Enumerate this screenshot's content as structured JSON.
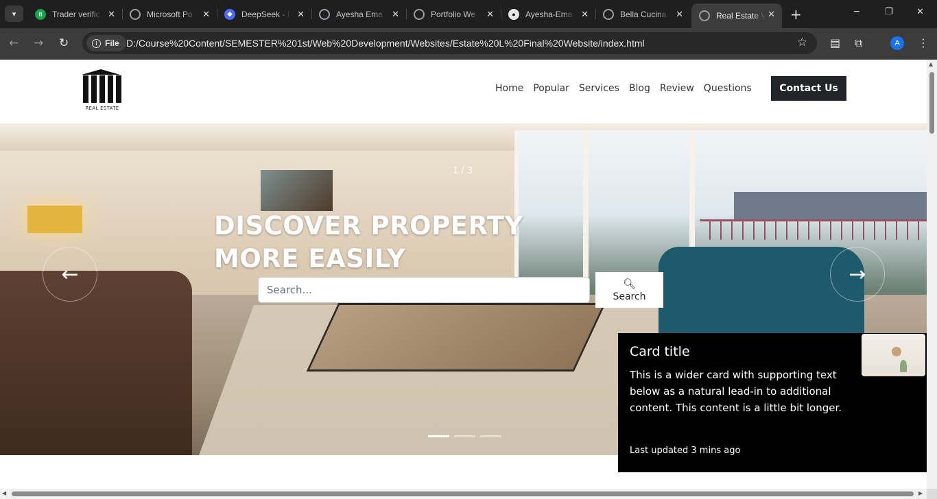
{
  "browser": {
    "tabs": [
      {
        "title": "Trader verific",
        "favicon": "fi",
        "favicon_color": "#16a34a",
        "active": false
      },
      {
        "title": "Microsoft Po",
        "favicon": "globe-icon",
        "active": false
      },
      {
        "title": "DeepSeek - I",
        "favicon": "deepseek-icon",
        "favicon_color": "#4d6bfe",
        "active": false
      },
      {
        "title": "Ayesha Ema",
        "favicon": "globe-icon",
        "active": false
      },
      {
        "title": "Portfolio We",
        "favicon": "globe-icon",
        "active": false
      },
      {
        "title": "Ayesha-Ema",
        "favicon": "github-icon",
        "active": false
      },
      {
        "title": "Bella Cucina",
        "favicon": "globe-icon",
        "active": false
      },
      {
        "title": "Real Estate V",
        "favicon": "globe-icon",
        "active": true
      }
    ],
    "security_chip": "File",
    "url": "D:/Course%20Content/SEMESTER%201st/Web%20Development/Websites/Estate%20L%20Final%20Website/index.html",
    "profile_initial": "A",
    "profile_color": "#1a73e8"
  },
  "site": {
    "logo": {
      "text": "REAL ESTATE"
    },
    "nav": [
      "Home",
      "Popular",
      "Services",
      "Blog",
      "Review",
      "Questions"
    ],
    "contact_label": "Contact Us",
    "hero": {
      "counter": "1 / 3",
      "title_line1": "DISCOVER PROPERTY",
      "title_line2": "MORE EASILY",
      "search_placeholder": "Search...",
      "search_button": "Search",
      "prev_arrow": "←",
      "next_arrow": "→",
      "slides": 3,
      "active_slide": 1
    },
    "card": {
      "title": "Card title",
      "text": "This is a wider card with supporting text below as a natural lead-in to additional content. This content is a little bit longer.",
      "footer": "Last updated 3 mins ago"
    }
  },
  "colors": {
    "chrome_dark": "#1f1f1f",
    "toolbar": "#3c3c3c",
    "contact_button": "#212529",
    "card_bg": "#000000"
  }
}
